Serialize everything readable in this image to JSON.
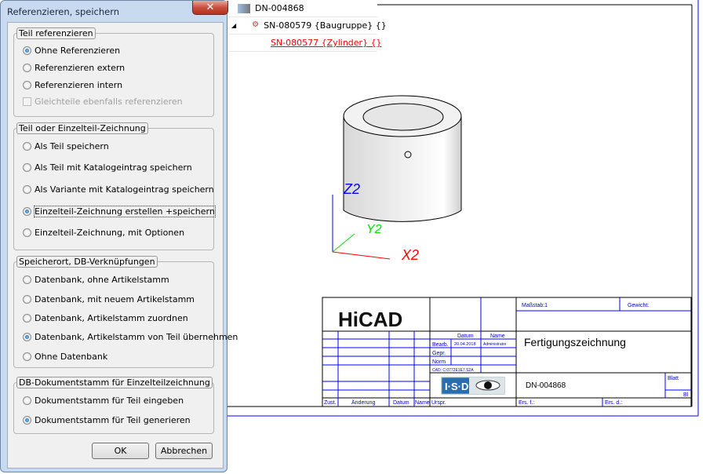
{
  "dialog": {
    "title": "Referenzieren, speichern",
    "close_icon": "x-icon",
    "groups": [
      {
        "label": "Teil referenzieren",
        "options": [
          {
            "label": "Ohne Referenzieren",
            "selected": true
          },
          {
            "label": "Referenzieren extern",
            "selected": false
          },
          {
            "label": "Referenzieren intern",
            "selected": false
          }
        ],
        "checkbox": {
          "label": "Gleichteile ebenfalls referenzieren",
          "checked": false,
          "enabled": false
        }
      },
      {
        "label": "Teil oder Einzelteil-Zeichnung",
        "options": [
          {
            "label": "Als Teil speichern",
            "selected": false
          },
          {
            "label": "Als Teil mit Katalogeintrag speichern",
            "selected": false
          },
          {
            "label": "Als Variante mit Katalogeintrag speichern",
            "selected": false
          },
          {
            "label": "Einzelteil-Zeichnung erstellen +speichern",
            "selected": true
          },
          {
            "label": "Einzelteil-Zeichnung, mit Optionen",
            "selected": false
          }
        ]
      },
      {
        "label": "Speicherort, DB-Verknüpfungen",
        "options": [
          {
            "label": "Datenbank, ohne Artikelstamm",
            "selected": false
          },
          {
            "label": "Datenbank, mit neuem Artikelstamm",
            "selected": false
          },
          {
            "label": "Datenbank, Artikelstamm zuordnen",
            "selected": false
          },
          {
            "label": "Datenbank, Artikelstamm von Teil übernehmen",
            "selected": true
          },
          {
            "label": "Ohne Datenbank",
            "selected": false
          }
        ]
      },
      {
        "label": "DB-Dokumentstamm für Einzelteilzeichnung",
        "options": [
          {
            "label": "Dokumentstamm für Teil eingeben",
            "selected": false
          },
          {
            "label": "Dokumentstamm für Teil generieren",
            "selected": true
          }
        ]
      }
    ],
    "ok_label": "OK",
    "cancel_label": "Abbrechen"
  },
  "tree": {
    "items": [
      {
        "label": "DN-004868",
        "icon": "drawing-database-icon"
      },
      {
        "label": "SN-080579 {Baugruppe} {}",
        "icon": "assembly-icon",
        "expanded": true
      },
      {
        "label": "SN-080577 {Zylinder} {}",
        "icon": "part-block-icon",
        "color": "#ff0000"
      }
    ]
  },
  "viewport": {
    "axes": {
      "x": "X2",
      "y": "Y2",
      "z": "Z2"
    },
    "axis_colors": {
      "x": "#ff0000",
      "y": "#00dd00",
      "z": "#0000ff"
    }
  },
  "title_block": {
    "logo": "HiCAD",
    "isd_logo": "I·S·D",
    "scale": "Maßstab:1",
    "weight": "Gewicht:",
    "col_date": "Datum",
    "col_name": "Name",
    "bearb": "Bearb.",
    "bearb_date": "20.04.2018",
    "bearb_name": "Administrator",
    "gepr": "Gepr.",
    "norm": "Norm",
    "cad": "CAD:  C:0772E1E7.S2A",
    "title": "Fertigungszeichnung",
    "drawing_no": "DN-004868",
    "blatt": "Blatt",
    "bl": "Bl",
    "zust": "Zust.",
    "aenderung": "Änderung",
    "datum": "Datum",
    "name": "Name",
    "urspr": "Urspr.",
    "ers_f": "Ers. f.:",
    "ers_d": "Ers. d.:"
  }
}
